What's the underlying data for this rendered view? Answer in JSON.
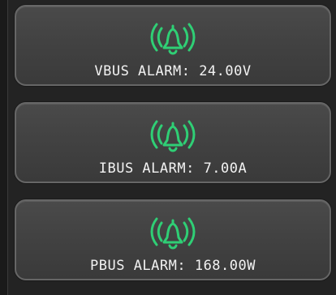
{
  "colors": {
    "icon": "#2fcf75",
    "text": "#f2f2f2",
    "background": "#232323"
  },
  "alarms": [
    {
      "label": "VBUS ALARM: 24.00V",
      "icon": "alarm-bell-icon"
    },
    {
      "label": "IBUS ALARM: 7.00A",
      "icon": "alarm-bell-icon"
    },
    {
      "label": "PBUS ALARM: 168.00W",
      "icon": "alarm-bell-icon"
    }
  ]
}
